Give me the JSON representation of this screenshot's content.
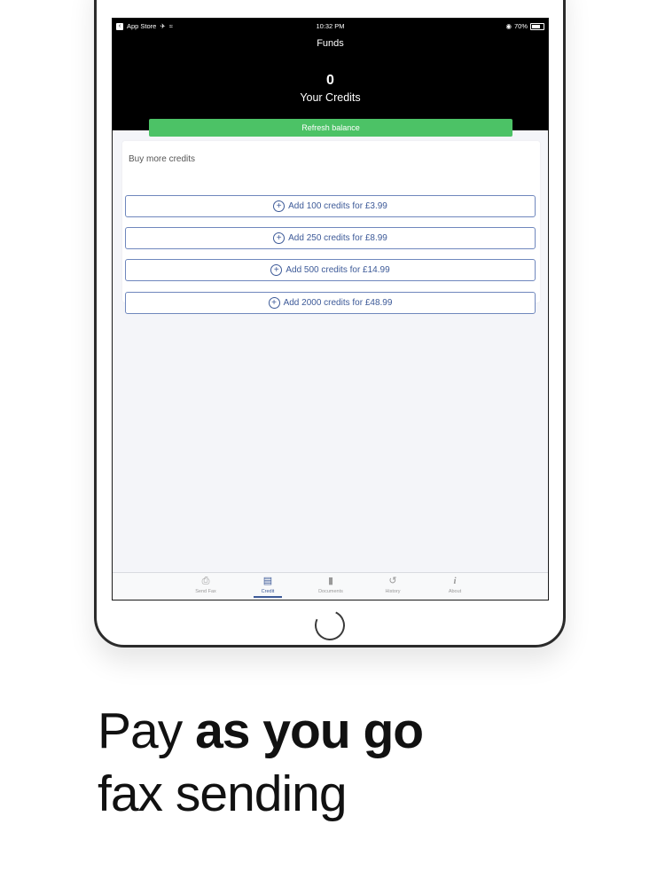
{
  "status_bar": {
    "back_app": "App Store",
    "time": "10:32 PM",
    "battery": "70%"
  },
  "nav": {
    "title": "Funds"
  },
  "balance": {
    "credits": "0",
    "label": "Your Credits",
    "refresh_label": "Refresh balance"
  },
  "buy": {
    "title": "Buy more credits",
    "options": [
      {
        "label": "Add 100 credits for £3.99"
      },
      {
        "label": "Add 250 credits for £8.99"
      },
      {
        "label": "Add 500 credits for £14.99"
      },
      {
        "label": "Add 2000 credits for £48.99"
      }
    ]
  },
  "tabs": [
    {
      "label": "Send Fax",
      "icon": "printer-icon"
    },
    {
      "label": "Credit",
      "icon": "credit-icon",
      "active": true
    },
    {
      "label": "Documents",
      "icon": "document-icon"
    },
    {
      "label": "History",
      "icon": "history-icon"
    },
    {
      "label": "About",
      "icon": "info-icon"
    }
  ],
  "tagline": {
    "line1_regular": "Pay ",
    "line1_bold": "as you go",
    "line2": "fax sending"
  },
  "colors": {
    "header_bg": "#000000",
    "refresh_green": "#4cc266",
    "accent_blue": "#3d5a98"
  }
}
